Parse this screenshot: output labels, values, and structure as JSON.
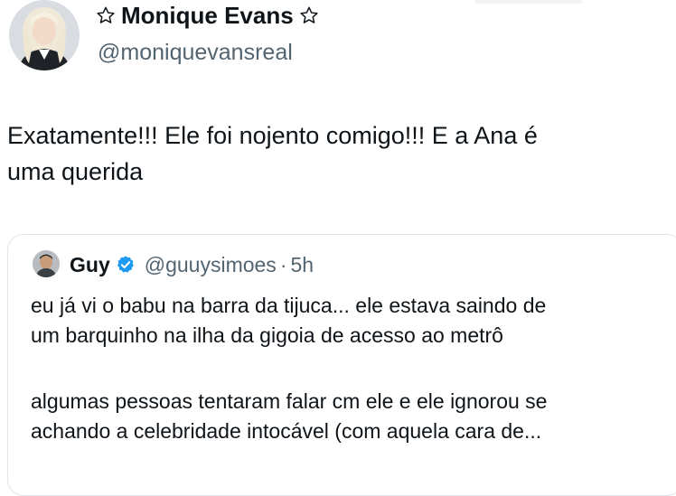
{
  "author": {
    "name": "Monique Evans",
    "handle": "@moniquevansreal",
    "name_decoration_icon": "star-outline-icon"
  },
  "tweet": {
    "text_line1": "Exatamente!!! Ele foi nojento comigo!!! E a Ana é",
    "text_line2": "uma querida"
  },
  "quoted_tweet": {
    "name": "Guy",
    "verified_icon": "verified-badge-icon",
    "handle": "@guuysimoes",
    "separator": "·",
    "time": "5h",
    "paragraph1_line1": "eu já vi o babu na barra da tijuca... ele estava saindo de",
    "paragraph1_line2": "um barquinho na ilha da gigoia de acesso ao metrô",
    "paragraph2_line1": "algumas pessoas tentaram falar cm ele e ele ignorou se",
    "paragraph2_line2": "achando a celebridade intocável (com aquela cara de..."
  },
  "colors": {
    "text": "#0f1419",
    "secondary_text": "#536471",
    "verified_blue": "#1d9bf0",
    "card_border": "#dfe5e9"
  }
}
